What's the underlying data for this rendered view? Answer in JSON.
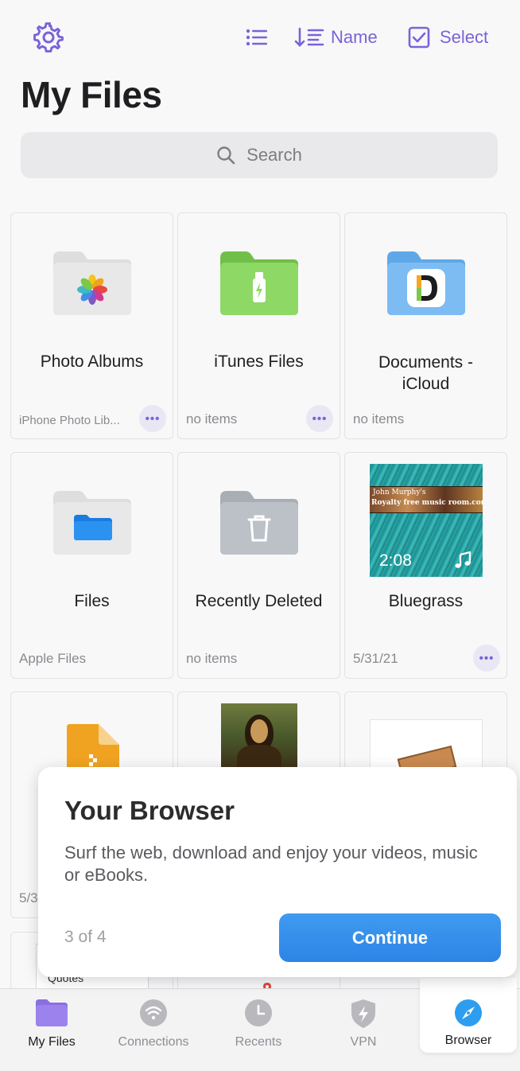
{
  "toolbar": {
    "sort_label": "Name",
    "select_label": "Select",
    "accent_color": "#7b63d8"
  },
  "page": {
    "title": "My Files"
  },
  "search": {
    "placeholder": "Search"
  },
  "items": [
    {
      "name": "Photo Albums",
      "subtitle": "iPhone Photo Lib...",
      "icon": "photos-folder-icon"
    },
    {
      "name": "iTunes Files",
      "subtitle": "no items",
      "icon": "itunes-usb-folder-icon"
    },
    {
      "name": "Documents - iCloud",
      "subtitle": "no items",
      "icon": "documents-icloud-folder-icon"
    },
    {
      "name": "Files",
      "subtitle": "Apple Files",
      "icon": "files-folder-icon"
    },
    {
      "name": "Recently Deleted",
      "subtitle": "no items",
      "icon": "trash-folder-icon"
    },
    {
      "name": "Bluegrass",
      "subtitle": "5/31/21",
      "icon": "audio-thumbnail",
      "duration": "2:08",
      "thumb_text_line1": "John Murphy's",
      "thumb_text_line2": "Royalty free music room.com"
    },
    {
      "name": "",
      "subtitle": "5/3",
      "icon": "archive-file-icon"
    },
    {
      "name": "",
      "subtitle": "",
      "icon": "mona-lisa-image-thumbnail"
    },
    {
      "name": "",
      "subtitle": "",
      "icon": "book-image-thumbnail"
    },
    {
      "name": "",
      "subtitle": "",
      "icon": "quotes-thumbnail",
      "thumb_text": "Quotes"
    }
  ],
  "popup": {
    "title": "Your Browser",
    "text": "Surf the web, download and enjoy your videos, music or eBooks.",
    "step": "3 of 4",
    "button": "Continue"
  },
  "tabs": [
    {
      "label": "My Files",
      "icon": "folder-icon",
      "active": true
    },
    {
      "label": "Connections",
      "icon": "wifi-icon"
    },
    {
      "label": "Recents",
      "icon": "clock-icon"
    },
    {
      "label": "VPN",
      "icon": "shield-bolt-icon"
    },
    {
      "label": "Browser",
      "icon": "compass-icon",
      "highlighted": true
    }
  ]
}
